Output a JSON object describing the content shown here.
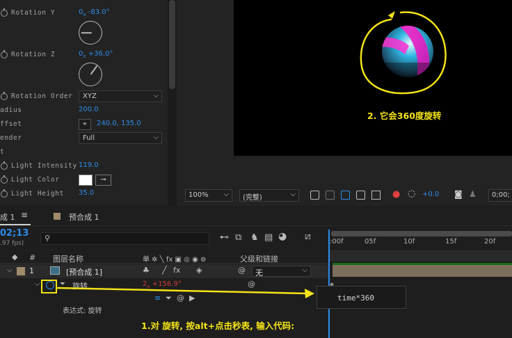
{
  "effect_controls": {
    "rows": [
      {
        "label": "Rotation Y",
        "value_prefix": "0",
        "value_sub": "x",
        "value": "-83.0°",
        "has_stopwatch": true
      },
      {
        "label": "Rotation Z",
        "value_prefix": "0",
        "value_sub": "x",
        "value": "+36.0°",
        "has_stopwatch": true
      },
      {
        "label": "Rotation Order",
        "dropdown": "XYZ",
        "has_stopwatch": true
      },
      {
        "label": "adius",
        "value": "200.0"
      },
      {
        "label": "ffset",
        "value": "240.0, 135.0"
      },
      {
        "label": "ender",
        "dropdown": "Full"
      },
      {
        "label": "t"
      },
      {
        "label": "Light Intensity",
        "value": "119.0",
        "has_stopwatch": true
      },
      {
        "label": "Light Color",
        "has_stopwatch": true,
        "swatch_color": "#ffffff"
      },
      {
        "label": "Light Height",
        "value": "35.0",
        "has_stopwatch": true
      }
    ]
  },
  "viewer": {
    "zoom": "100%",
    "resolution": "(完整)",
    "exposure": "+0.0",
    "timecode_partial": "0;00;",
    "annotation": "2. 它会360度旋转"
  },
  "timeline": {
    "tabs": [
      {
        "label": "成 1",
        "active": true
      },
      {
        "label": "预合成 1",
        "active": false
      }
    ],
    "tab_menu_icon": "≡",
    "timecode": "02;13",
    "fps": ".97 fps)",
    "search_placeholder": "",
    "columns": {
      "hash": "#",
      "layer_name": "图层名称",
      "switches": "单 ✲ ╲ fx ▣ ◎ ◉ ⊚",
      "parent": "父级和链接"
    },
    "layer": {
      "index": "1",
      "name": "[预合成 1]",
      "parent_value": "无",
      "swatch_color": "#a08c6b"
    },
    "property": {
      "name": "旋转",
      "value_prefix": "2",
      "value_sub": "x",
      "value": "+156.9°",
      "expression_label": "表达式: 旋转"
    },
    "ruler_labels": [
      ":00f",
      "05f",
      "10f",
      "15f",
      "20f"
    ],
    "expression": "time*360",
    "annotation": "1.对 旋转, 按alt+点击秒表, 输入代码:"
  },
  "colors": {
    "accent_blue": "#2d8ceb",
    "annotation_yellow": "#f3e317",
    "value_red": "#d23a3a"
  }
}
